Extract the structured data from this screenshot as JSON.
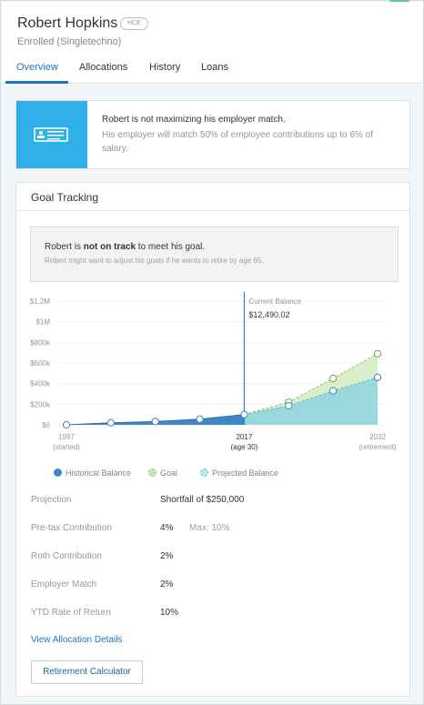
{
  "header": {
    "name": "Robert Hopkins",
    "badge": "HCE",
    "enrollment": "Enrolled (Singletechno)",
    "tabs": [
      {
        "label": "Overview",
        "active": true
      },
      {
        "label": "Allocations",
        "active": false
      },
      {
        "label": "History",
        "active": false
      },
      {
        "label": "Loans",
        "active": false
      }
    ]
  },
  "alert": {
    "icon": "id-card-icon",
    "title": "Robert is not maximizing his employer match.",
    "description": "His employer will match 50% of employee contributions up to 6% of salary."
  },
  "goal_tracking": {
    "title": "Goal Tracking",
    "status_prefix": "Robert is ",
    "status_bold": "not on track",
    "status_suffix": " to meet his goal.",
    "status_sub": "Robert might want to adjust his goals if he wants to retire by age 65."
  },
  "chart_data": {
    "type": "area",
    "y_ticks": [
      "$1.2M",
      "$1M",
      "$800k",
      "$600k",
      "$400k",
      "$200k",
      "$0"
    ],
    "ylim": [
      0,
      1200000
    ],
    "x_ticks": [
      {
        "year": "1997",
        "note": "(started)"
      },
      {
        "year": "2017",
        "note": "(age 30)"
      },
      {
        "year": "2032",
        "note": "(retirement)"
      }
    ],
    "xlim": [
      1997,
      2032
    ],
    "marker": {
      "x": 2017,
      "label": "Current Balance",
      "value": "$12,490.02"
    },
    "series": [
      {
        "name": "Historical Balance",
        "color": "#3c86c9",
        "points": [
          [
            1997,
            0
          ],
          [
            2002,
            20000
          ],
          [
            2007,
            32000
          ],
          [
            2012,
            55000
          ],
          [
            2017,
            100000
          ]
        ]
      },
      {
        "name": "Goal",
        "color": "#8fc56a",
        "points": [
          [
            2017,
            100000
          ],
          [
            2022,
            220000
          ],
          [
            2027,
            450000
          ],
          [
            2032,
            690000
          ]
        ]
      },
      {
        "name": "Projected Balance",
        "color": "#5dc1cf",
        "points": [
          [
            2017,
            100000
          ],
          [
            2022,
            185000
          ],
          [
            2027,
            330000
          ],
          [
            2032,
            460000
          ]
        ]
      }
    ],
    "grid": true
  },
  "details": {
    "rows": [
      {
        "label": "Projection",
        "value": "Shortfall of $250,000",
        "extra": ""
      },
      {
        "label": "Pre-tax Contribution",
        "value": "4%",
        "extra": "Max: 10%"
      },
      {
        "label": "Roth Contribution",
        "value": "2%",
        "extra": ""
      },
      {
        "label": "Employer Match",
        "value": "2%",
        "extra": ""
      },
      {
        "label": "YTD Rate of Return",
        "value": "10%",
        "extra": ""
      }
    ],
    "link": "View Allocation Details",
    "button": "Retirement Calculator"
  }
}
